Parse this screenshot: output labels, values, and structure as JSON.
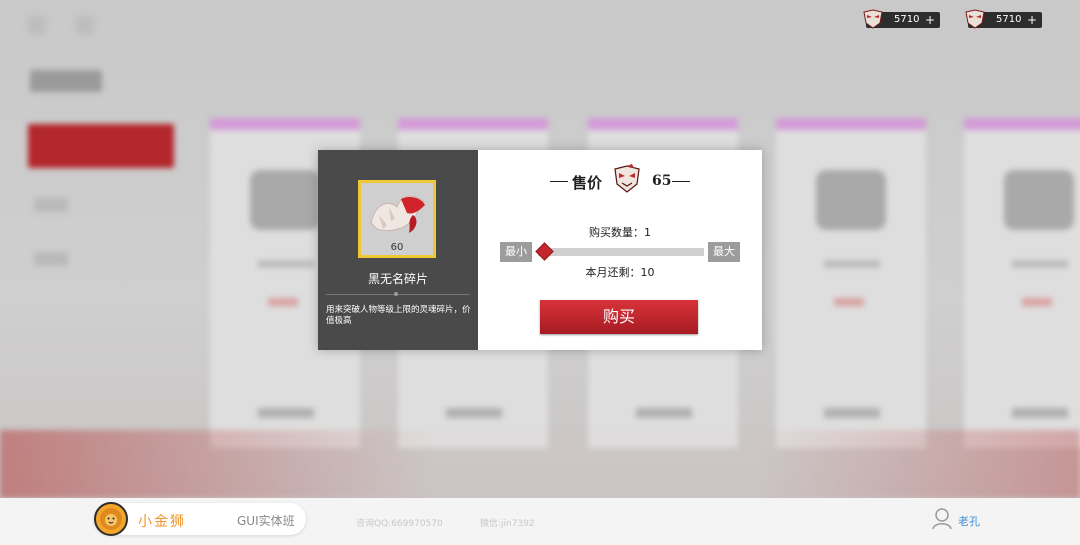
{
  "currency": [
    {
      "amount": "5710",
      "plus": "+",
      "icon": "mask-coin-icon"
    },
    {
      "amount": "5710",
      "plus": "+",
      "icon": "mask-coin-icon"
    }
  ],
  "dialog": {
    "item": {
      "name": "黑无名碎片",
      "quantity": "60",
      "description": "用来突破人物等级上限的灵魂碎片，价值极高"
    },
    "price_label": "售价",
    "price_value": "65",
    "quantity_label": "购买数量：1",
    "min_label": "最小",
    "max_label": "最大",
    "slider_value": 1,
    "slider_max": 10,
    "remaining_label": "本月还剩：10",
    "buy_label": "购买"
  },
  "footer": {
    "brand_name": "小金狮",
    "course": "GUI实体班",
    "contact_qq": "咨询QQ:669970570",
    "contact_wechat": "微信:jin7392",
    "user_name": "老孔"
  },
  "colors": {
    "accent_red": "#c4262d",
    "frame_gold": "#f0c836",
    "brand_orange": "#f0932b",
    "user_blue": "#3a8fd8"
  }
}
